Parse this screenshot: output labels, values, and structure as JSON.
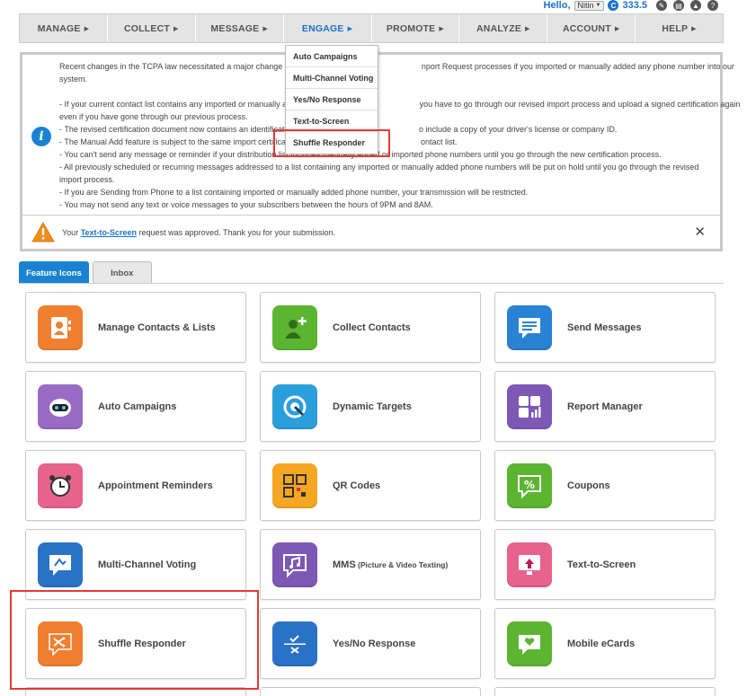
{
  "topbar": {
    "greeting": "Hello,",
    "user": "Nitin",
    "credits": "333.5",
    "credit_symbol": "C"
  },
  "nav": {
    "items": [
      {
        "label": "MANAGE"
      },
      {
        "label": "COLLECT"
      },
      {
        "label": "MESSAGE"
      },
      {
        "label": "ENGAGE"
      },
      {
        "label": "PROMOTE"
      },
      {
        "label": "ANALYZE"
      },
      {
        "label": "ACCOUNT"
      },
      {
        "label": "HELP"
      }
    ],
    "active_index": 3,
    "caret": "▶"
  },
  "engage_dropdown": {
    "items": [
      "Auto Campaigns",
      "Multi-Channel Voting",
      "Yes/No Response",
      "Text-to-Screen",
      "Shuffle Responder"
    ],
    "highlighted": "Shuffle Responder"
  },
  "notice": {
    "lines": [
      "Recent changes in the TCPA law necessitated a major change in                                                          nport Request processes if you imported or manually added any phone number into our",
      "system.",
      "",
      "- If your current contact list contains any imported or manually a                                                           you have to go through our revised import process and upload a signed certification again",
      "even if you have gone through our previous process.",
      "- The revised certification document now contains an identificati                                                           o include a copy of your driver's license or company ID.",
      "- The Manual Add feature is subject to the same import certificat                                                           ontact list.",
      "- You can't send any message or reminder if your distribution list includes manually added or imported phone numbers until you go through the new certification process.",
      "- All previously scheduled or recurring messages addressed to a list containing any imported or manually added phone numbers will be put on hold until you go through the revised",
      "import process.",
      "- If you are Sending from Phone to a list containing imported or manually added phone number, your transmission will be restricted.",
      "- You may not send any text or voice messages to your subscribers between the hours of 9PM and 8AM."
    ],
    "footer_prefix": "Your ",
    "footer_link": "Text-to-Screen",
    "footer_suffix": " request was approved. Thank you for your submission.",
    "close": "✕"
  },
  "tabs": [
    {
      "label": "Feature Icons",
      "active": true
    },
    {
      "label": "Inbox",
      "active": false
    }
  ],
  "features": [
    {
      "label": "Manage Contacts & Lists",
      "icon": "contacts-icon",
      "color": "#f07f2f"
    },
    {
      "label": "Collect Contacts",
      "icon": "add-person-icon",
      "color": "#5cb531"
    },
    {
      "label": "Send Messages",
      "icon": "message-icon",
      "color": "#2a82d4"
    },
    {
      "label": "Auto Campaigns",
      "icon": "robot-icon",
      "color": "#9a6bc4"
    },
    {
      "label": "Dynamic Targets",
      "icon": "target-icon",
      "color": "#2a9fdc"
    },
    {
      "label": "Report Manager",
      "icon": "report-icon",
      "color": "#7d58b5"
    },
    {
      "label": "Appointment Reminders",
      "icon": "alarm-clock-icon",
      "color": "#e8628e"
    },
    {
      "label": "QR Codes",
      "icon": "qr-code-icon",
      "color": "#f5a623"
    },
    {
      "label": "Coupons",
      "icon": "coupon-icon",
      "color": "#5cb531"
    },
    {
      "label": "Multi-Channel Voting",
      "icon": "voting-icon",
      "color": "#2a72c8"
    },
    {
      "label": "MMS",
      "label_suffix": "(Picture & Video Texting)",
      "icon": "mms-icon",
      "color": "#7d58b5"
    },
    {
      "label": "Text-to-Screen",
      "icon": "screen-icon",
      "color": "#e8628e"
    },
    {
      "label": "Shuffle Responder",
      "icon": "shuffle-icon",
      "color": "#f07f2f"
    },
    {
      "label": "Yes/No Response",
      "icon": "yes-no-icon",
      "color": "#2a72c8"
    },
    {
      "label": "Mobile eCards",
      "icon": "ecard-icon",
      "color": "#5cb531"
    }
  ]
}
